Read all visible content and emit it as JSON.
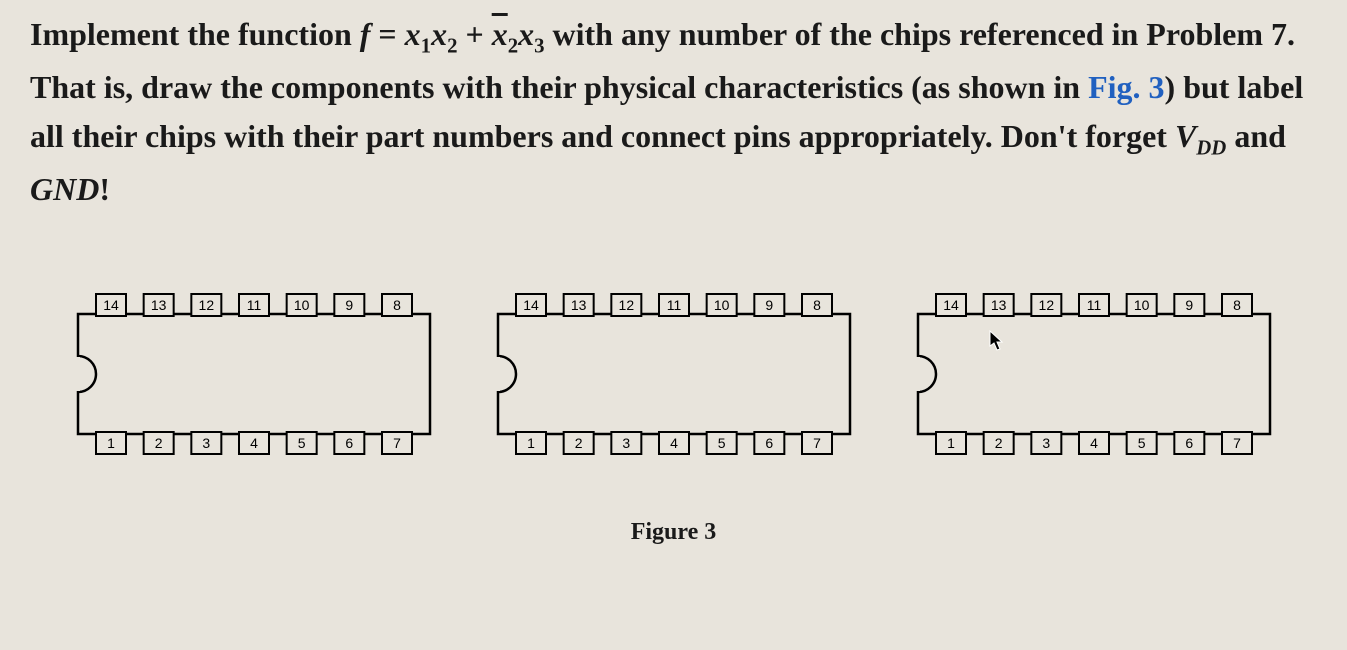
{
  "problem": {
    "p1a": "Implement the function ",
    "fvar": "f",
    "eq": " = ",
    "x1": "x",
    "s1": "1",
    "x2": "x",
    "s2": "2",
    "plus": " + ",
    "x2b": "x",
    "s2b": "2",
    "x3": "x",
    "s3": "3",
    "p1b": " with any number of the chips referenced in Problem 7. That is, draw the components with their physical characteristics (as shown in ",
    "figref": "Fig. 3",
    "p1c": ") but label all their chips with their part numbers and connect pins appropriately. Don't forget ",
    "vdd_v": "V",
    "vdd_sub": "DD",
    "and": " and ",
    "gnd": "GND",
    "excl": "!"
  },
  "chip": {
    "top_pins": [
      "14",
      "13",
      "12",
      "11",
      "10",
      "9",
      "8"
    ],
    "bottom_pins": [
      "1",
      "2",
      "3",
      "4",
      "5",
      "6",
      "7"
    ]
  },
  "chips_count": 3,
  "caption": "Figure 3"
}
